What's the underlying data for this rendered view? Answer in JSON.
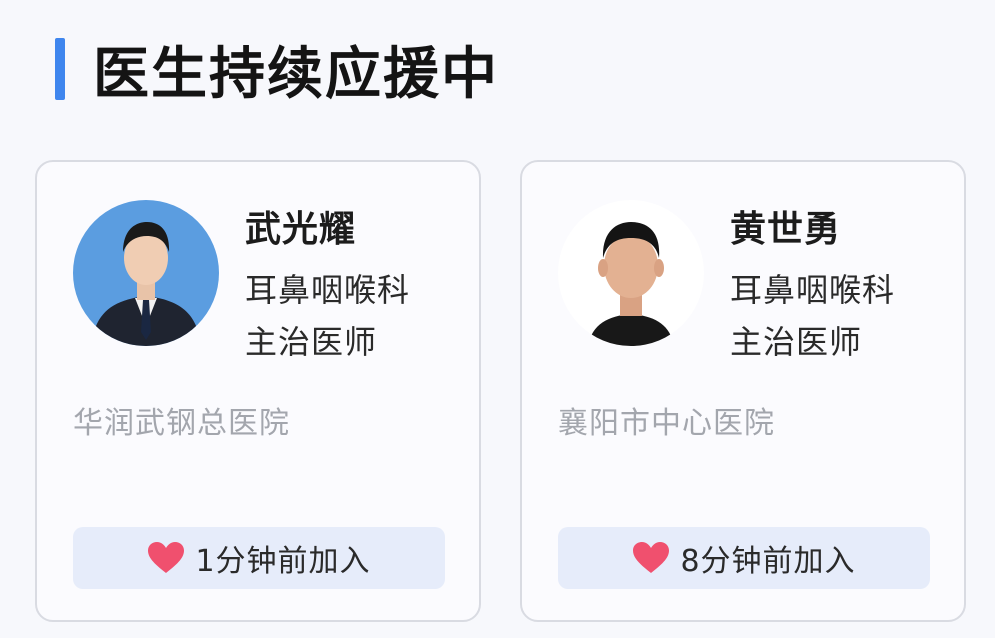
{
  "header": {
    "title": "医生持续应援中",
    "accent_color": "#3f86ee"
  },
  "doctors": [
    {
      "name": "武光耀",
      "department": "耳鼻咽喉科",
      "title": "主治医师",
      "hospital": "华润武钢总医院",
      "joined": "1分钟前加入",
      "avatar_icon": "doctor-portrait-blue-background"
    },
    {
      "name": "黄世勇",
      "department": "耳鼻咽喉科",
      "title": "主治医师",
      "hospital": "襄阳市中心医院",
      "joined": "8分钟前加入",
      "avatar_icon": "doctor-portrait-white-background"
    }
  ],
  "colors": {
    "heart": "#f0506e",
    "pill_bg": "#e6ecfa",
    "hospital_text": "#a3a6ad"
  }
}
